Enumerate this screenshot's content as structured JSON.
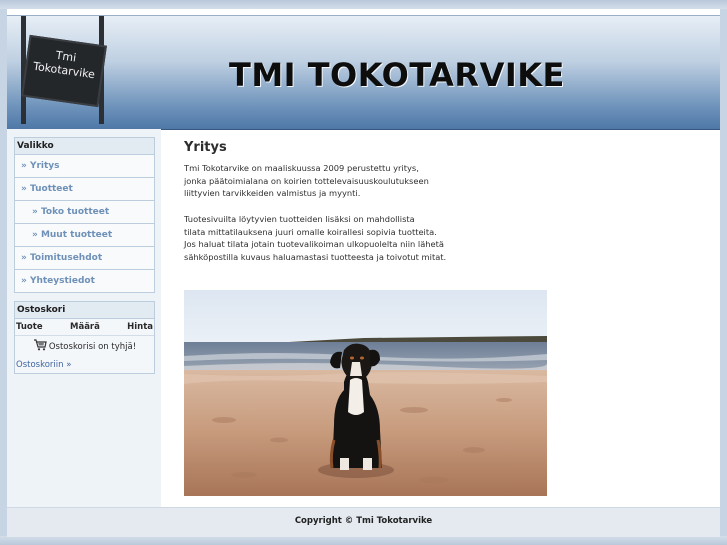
{
  "header": {
    "sign_line1": "Tmi",
    "sign_line2": "Tokotarvike",
    "title": "TMI TOKOTARVIKE"
  },
  "menu": {
    "heading": "Valikko",
    "items": [
      {
        "label": "» Yritys"
      },
      {
        "label": "» Tuotteet"
      },
      {
        "label": "» Toko tuotteet"
      },
      {
        "label": "» Muut tuotteet"
      },
      {
        "label": "» Toimitusehdot"
      },
      {
        "label": "» Yhteystiedot"
      }
    ]
  },
  "cart": {
    "heading": "Ostoskori",
    "col_product": "Tuote",
    "col_qty": "Määrä",
    "col_price": "Hinta",
    "empty_text": "Ostoskorisi on tyhjä!",
    "link": "Ostoskoriin »"
  },
  "content": {
    "title": "Yritys",
    "para1": [
      "Tmi Tokotarvike on maaliskuussa 2009 perustettu yritys,",
      "jonka päätoimialana on koirien tottelevaisuuskoulutukseen",
      "liittyvien tarvikkeiden valmistus ja myynti."
    ],
    "para2": [
      "Tuotesivuilta löytyvien tuotteiden lisäksi on mahdollista",
      "tilata mittatilauksena juuri omalle koirallesi sopivia tuotteita.",
      "Jos haluat tilata jotain tuotevalikoiman ulkopuolelta niin lähetä",
      "sähköpostilla kuvaus haluamastasi tuotteesta ja toivotut mitat."
    ]
  },
  "footer": {
    "copyright": "Copyright © Tmi Tokotarvike"
  },
  "colors": {
    "menu_link": "#6f91b8",
    "header_dark": "#4f78a7",
    "panel_border": "#bccddd"
  }
}
